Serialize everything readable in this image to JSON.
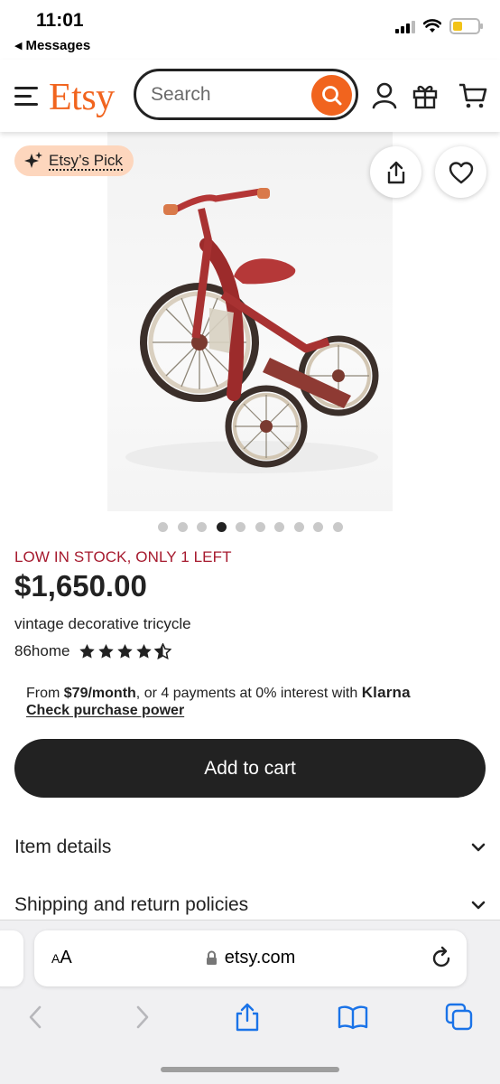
{
  "status_bar": {
    "time": "11:01",
    "back_label": "Messages",
    "battery_level": 0.38,
    "battery_color": "#f2c318"
  },
  "header": {
    "logo": "Etsy",
    "search_placeholder": "Search",
    "icons": [
      "menu-icon",
      "search-icon",
      "account-icon",
      "gift-icon",
      "cart-icon"
    ],
    "accent_color": "#f1641e"
  },
  "product": {
    "badge": "Etsy’s Pick",
    "image_count": 10,
    "active_image": 4,
    "stock_notice": "LOW IN STOCK, ONLY 1 LEFT",
    "price": "$1,650.00",
    "title": "vintage decorative tricycle",
    "shop_name": "86home",
    "rating": 4.5,
    "rating_max": 5
  },
  "financing": {
    "prefix": "From ",
    "amount": "$79/month",
    "suffix": ", or 4 payments at 0% interest with ",
    "provider": "Klarna",
    "link": "Check purchase power"
  },
  "actions": {
    "add_to_cart": "Add to cart"
  },
  "accordions": [
    {
      "label": "Item details"
    },
    {
      "label": "Shipping and return policies"
    }
  ],
  "browser": {
    "aa_label_small": "A",
    "aa_label_large": "A",
    "url": "etsy.com"
  }
}
